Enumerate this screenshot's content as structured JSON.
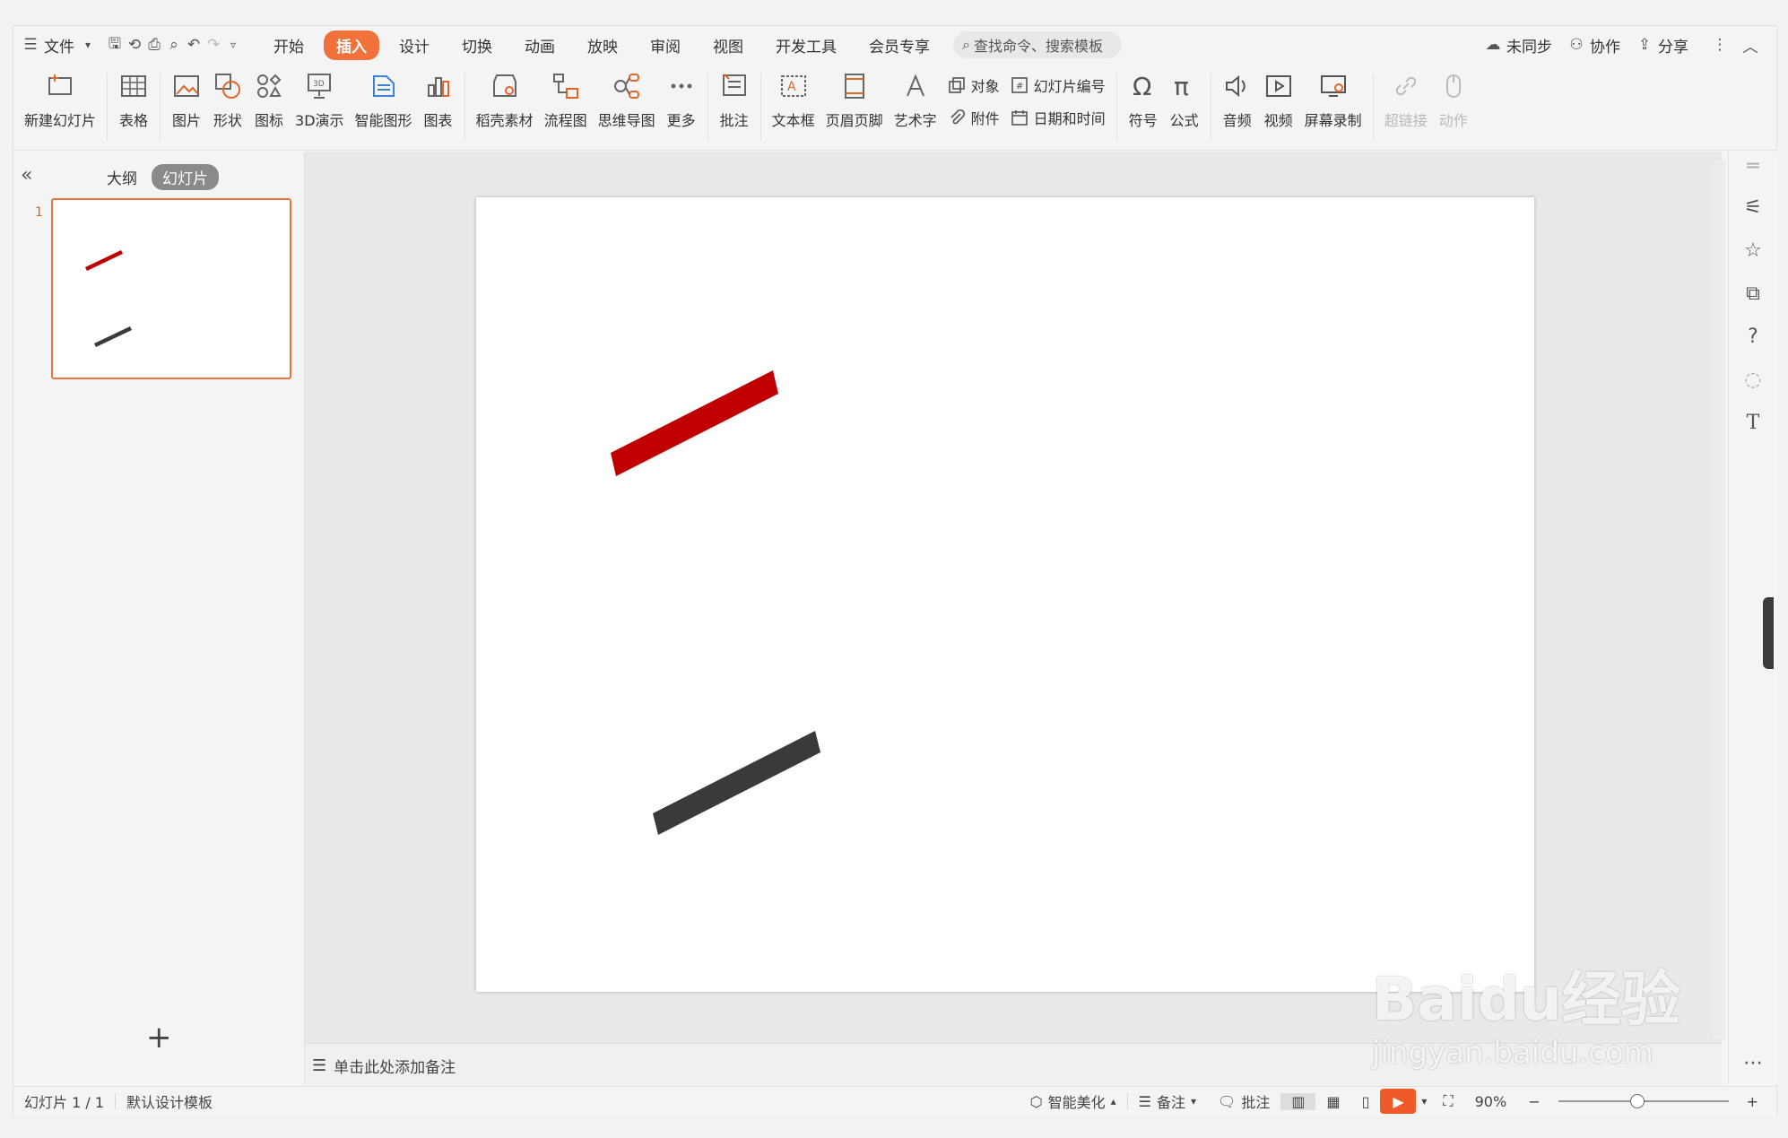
{
  "topbar": {
    "file_label": "文件",
    "tabs": [
      "开始",
      "插入",
      "设计",
      "切换",
      "动画",
      "放映",
      "审阅",
      "视图",
      "开发工具",
      "会员专享"
    ],
    "active_tab": "插入",
    "search_placeholder": "查找命令、搜索模板",
    "sync_label": "未同步",
    "collab_label": "协作",
    "share_label": "分享"
  },
  "ribbon": {
    "new_slide": "新建幻灯片",
    "table": "表格",
    "picture": "图片",
    "shape": "形状",
    "icon": "图标",
    "demo3d": "3D演示",
    "smartart": "智能图形",
    "chart": "图表",
    "material": "稻壳素材",
    "flowchart": "流程图",
    "mindmap": "思维导图",
    "more": "更多",
    "comment": "批注",
    "textbox": "文本框",
    "header_footer": "页眉页脚",
    "wordart": "艺术字",
    "object": "对象",
    "slide_number": "幻灯片编号",
    "attachment": "附件",
    "datetime": "日期和时间",
    "symbol": "符号",
    "formula": "公式",
    "audio": "音频",
    "video": "视频",
    "screen_record": "屏幕录制",
    "hyperlink": "超链接",
    "action": "动作"
  },
  "leftpanel": {
    "outline_tab": "大纲",
    "slides_tab": "幻灯片",
    "slide_number": "1",
    "add_slide": "+"
  },
  "slide": {
    "shapes": [
      {
        "name": "red-bar",
        "color": "#c00000"
      },
      {
        "name": "dark-bar",
        "color": "#3a3a3a"
      }
    ]
  },
  "notes": {
    "placeholder": "单击此处添加备注"
  },
  "statusbar": {
    "slide_info": "幻灯片 1 / 1",
    "template": "默认设计模板",
    "beautify": "智能美化",
    "notes": "备注",
    "comments": "批注",
    "zoom": "90%"
  },
  "watermark": {
    "brand": "Baidu经验",
    "url": "jingyan.baidu.com"
  }
}
